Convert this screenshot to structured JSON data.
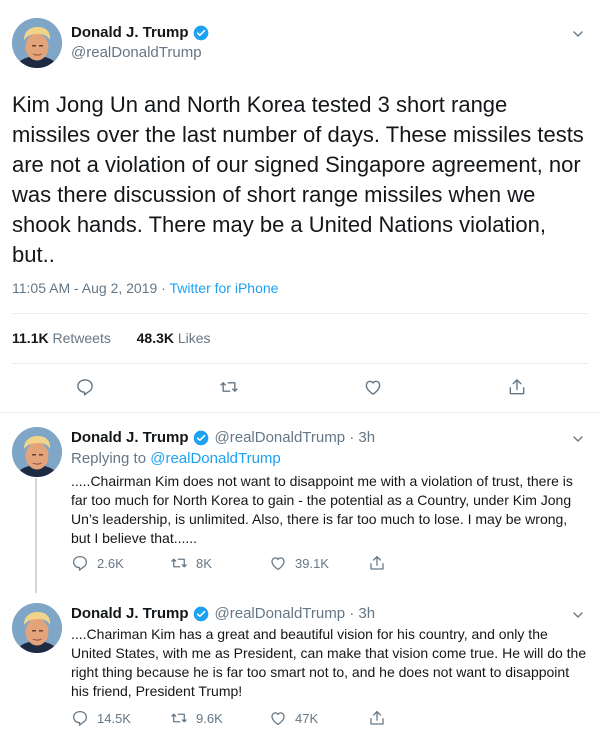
{
  "main": {
    "author": {
      "name": "Donald J. Trump",
      "handle": "@realDonaldTrump"
    },
    "text": "Kim Jong Un and North Korea tested 3 short range missiles over the last number of days. These missiles tests are not a violation of our signed Singapore agreement, nor was there discussion of short range missiles when we shook hands. There may be a United Nations violation, but..",
    "time": "11:05 AM - Aug 2, 2019",
    "dot": " · ",
    "source": "Twitter for iPhone",
    "retweets_count": "11.1K",
    "retweets_label": "Retweets",
    "likes_count": "48.3K",
    "likes_label": "Likes"
  },
  "replies": [
    {
      "name": "Donald J. Trump",
      "handle": "@realDonaldTrump · 3h",
      "replying_prefix": "Replying to ",
      "replying_to": "@realDonaldTrump",
      "text": ".....Chairman Kim does not want to disappoint me with a violation of trust, there is far too much for North Korea to gain - the potential as a Country, under Kim Jong Un’s leadership, is unlimited. Also, there is far too much to lose. I may be wrong, but I believe that......",
      "replies": "2.6K",
      "retweets": "8K",
      "likes": "39.1K"
    },
    {
      "name": "Donald J. Trump",
      "handle": "@realDonaldTrump · 3h",
      "text": "....Chariman Kim has a great and beautiful vision for his country, and only the United States, with me as President, can make that vision come true. He will do the right thing because he is far too smart not to, and he does not want to disappoint his friend, President Trump!",
      "replies": "14.5K",
      "retweets": "9.6K",
      "likes": "47K"
    }
  ],
  "colors": {
    "accent": "#1da1f2",
    "muted": "#657786",
    "text": "#14171a",
    "border": "#e6ecf0"
  },
  "icons": [
    "verified-badge-icon",
    "chevron-down-icon",
    "reply-icon",
    "retweet-icon",
    "like-icon",
    "share-icon"
  ]
}
